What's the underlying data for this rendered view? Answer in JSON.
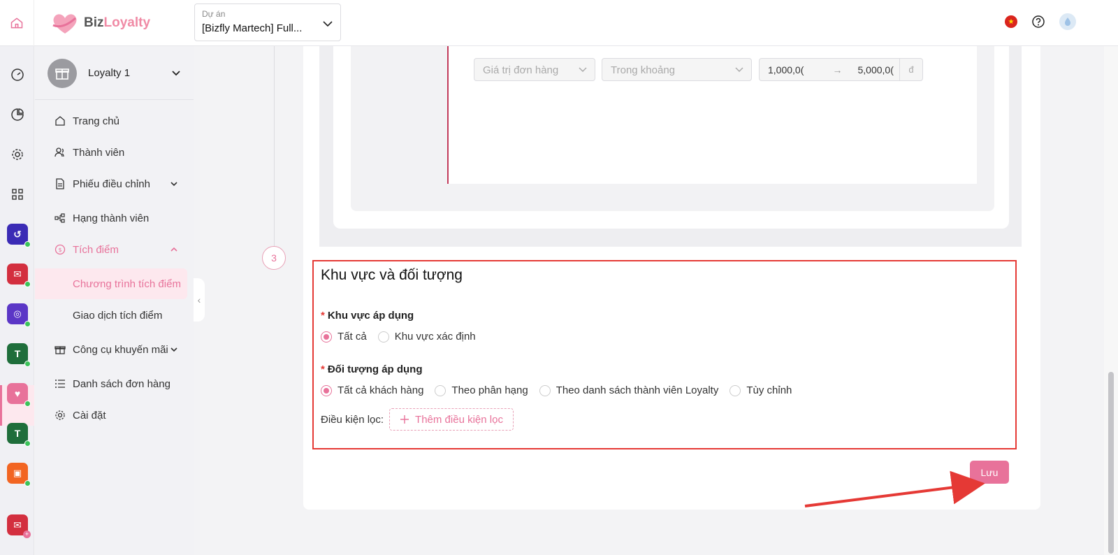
{
  "header": {
    "logo_text_main": "Biz",
    "logo_text_accent": "Loyalty",
    "project_label": "Dự án",
    "project_value": "[Bizfly Martech] Full..."
  },
  "sidebar": {
    "program_name": "Loyalty 1",
    "items": [
      {
        "label": "Trang chủ",
        "icon": "home-icon"
      },
      {
        "label": "Thành viên",
        "icon": "members-icon"
      },
      {
        "label": "Phiếu điều chỉnh",
        "icon": "document-icon"
      },
      {
        "label": "Hạng thành viên",
        "icon": "tier-icon"
      },
      {
        "label": "Tích điểm",
        "icon": "coin-icon"
      },
      {
        "label": "Chương trình tích điểm"
      },
      {
        "label": "Giao dịch tích điểm"
      },
      {
        "label": "Công cụ khuyến mãi",
        "icon": "gift-icon"
      },
      {
        "label": "Danh sách đơn hàng",
        "icon": "list-icon"
      },
      {
        "label": "Cài đặt",
        "icon": "gear-icon"
      }
    ]
  },
  "condition_row": {
    "field": "Giá trị đơn hàng",
    "operator": "Trong khoảng",
    "from": "1,000,0(",
    "to": "5,000,0(",
    "unit": "đ"
  },
  "step3": {
    "number": "3",
    "title": "Khu vực và đối tượng",
    "region_label": "Khu vực áp dụng",
    "region_options": [
      "Tất cả",
      "Khu vực xác định"
    ],
    "audience_label": "Đối tượng áp dụng",
    "audience_options": [
      "Tất cả khách hàng",
      "Theo phân hạng",
      "Theo danh sách thành viên Loyalty",
      "Tùy chỉnh"
    ],
    "filter_label": "Điều kiện lọc:",
    "add_filter": "Thêm điều kiện lọc",
    "required_mark": "*"
  },
  "actions": {
    "save": "Lưu"
  },
  "colors": {
    "accent": "#e8729a",
    "highlight": "#e53935"
  }
}
